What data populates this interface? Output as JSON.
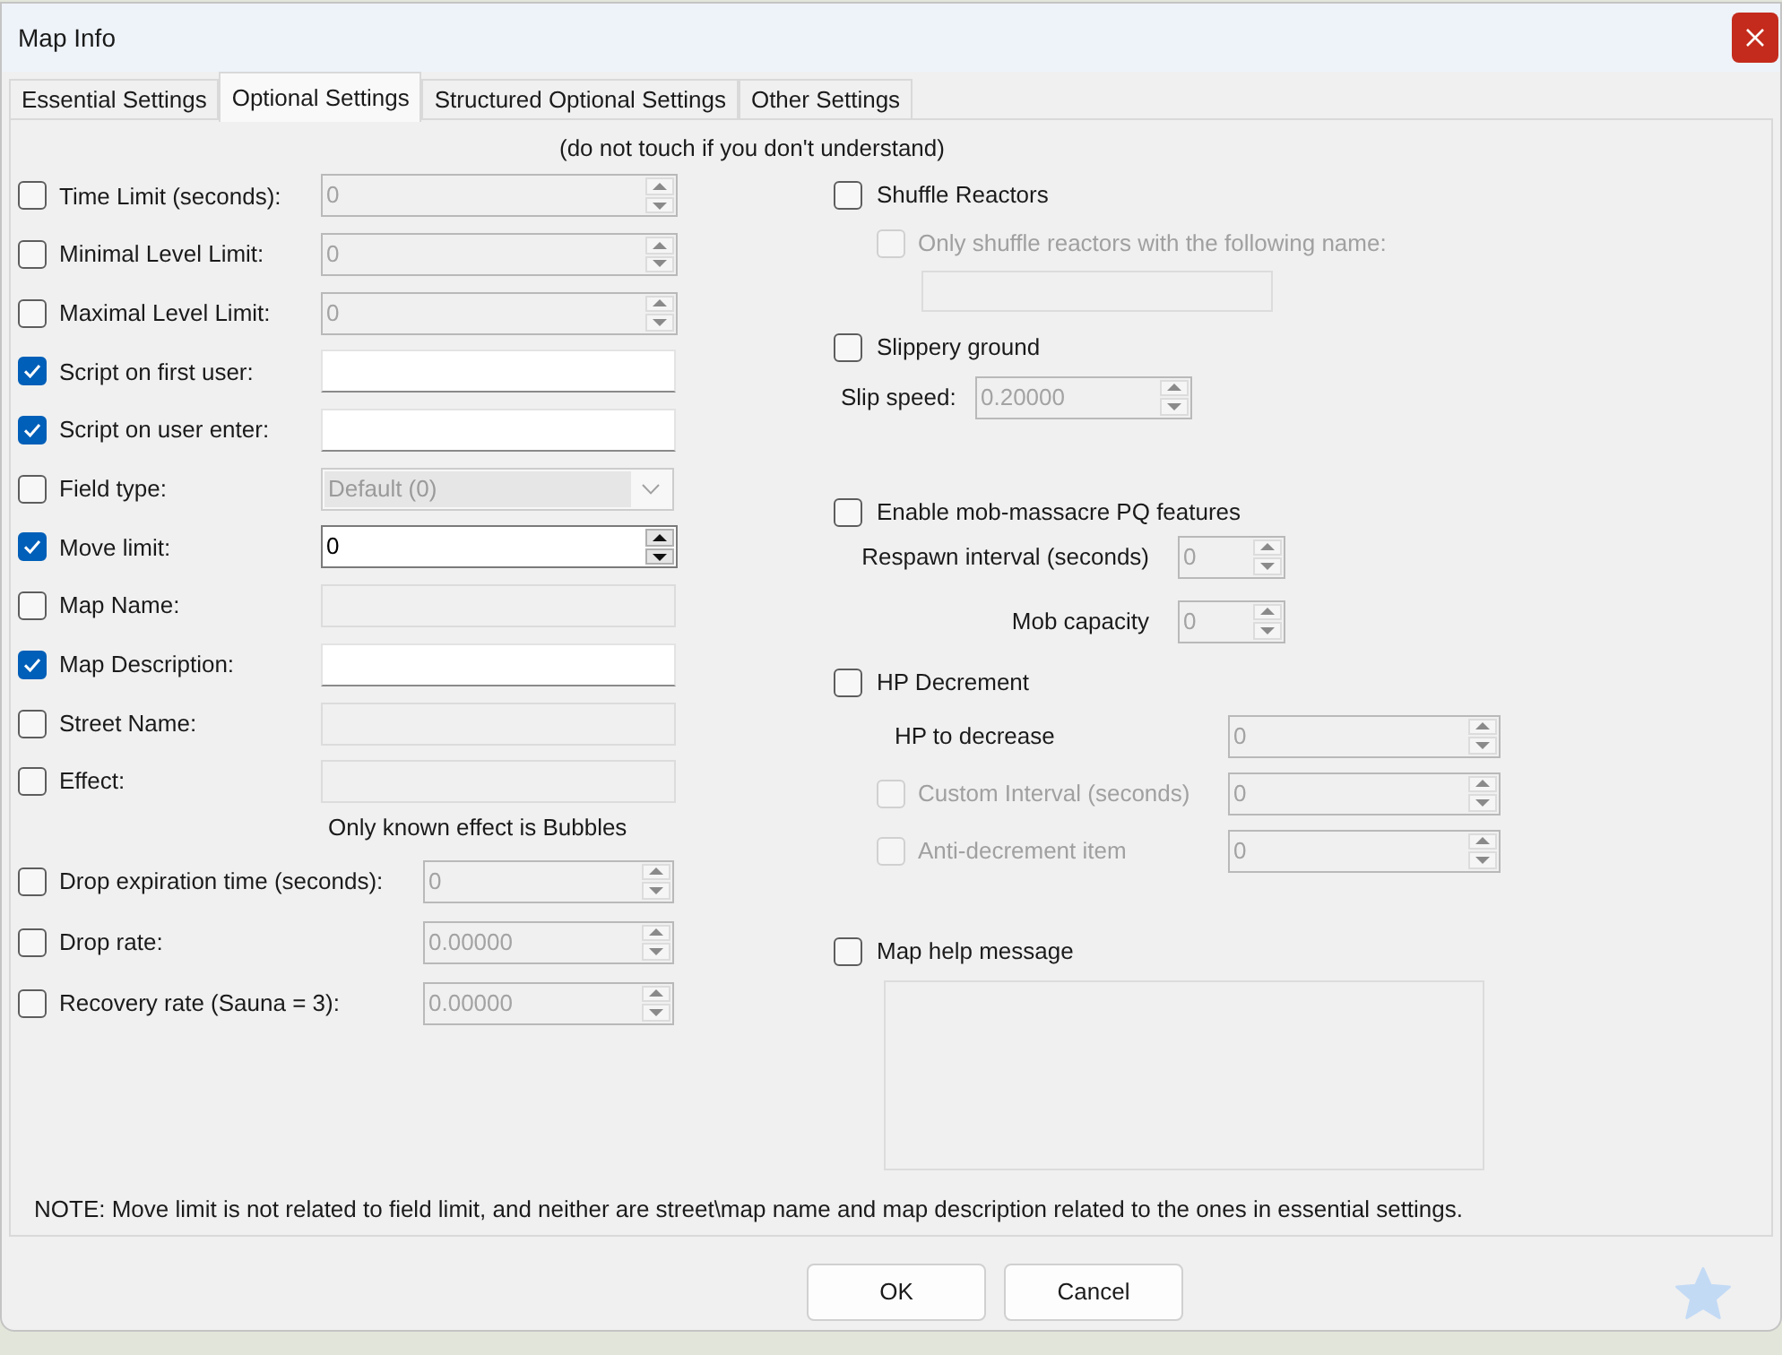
{
  "window": {
    "title": "Map Info"
  },
  "tabs": [
    {
      "label": "Essential Settings",
      "selected": false
    },
    {
      "label": "Optional Settings",
      "selected": true
    },
    {
      "label": "Structured Optional Settings",
      "selected": false
    },
    {
      "label": "Other Settings",
      "selected": false
    }
  ],
  "hint": "(do not touch if you don't understand)",
  "left_settings": [
    {
      "kind": "spin",
      "label": "Time Limit (seconds):",
      "checked": false,
      "value": "0"
    },
    {
      "kind": "spin",
      "label": "Minimal Level Limit:",
      "checked": false,
      "value": "0"
    },
    {
      "kind": "spin",
      "label": "Maximal Level Limit:",
      "checked": false,
      "value": "0"
    },
    {
      "kind": "text",
      "label": "Script on first user:",
      "checked": true
    },
    {
      "kind": "text",
      "label": "Script on user enter:",
      "checked": true
    },
    {
      "kind": "combo",
      "label": "Field type:",
      "checked": false,
      "value": "Default (0)"
    },
    {
      "kind": "spin",
      "label": "Move limit:",
      "checked": true,
      "value": "0"
    },
    {
      "kind": "text",
      "label": "Map Name:",
      "checked": false
    },
    {
      "kind": "text",
      "label": "Map Description:",
      "checked": true
    },
    {
      "kind": "text",
      "label": "Street Name:",
      "checked": false
    },
    {
      "kind": "text",
      "label": "Effect:",
      "checked": false
    },
    {
      "kind": "note",
      "label": "Only known effect is Bubbles"
    }
  ],
  "rate_settings": [
    {
      "label": "Drop expiration time (seconds):",
      "checked": false,
      "value": "0"
    },
    {
      "label": "Drop rate:",
      "checked": false,
      "value": "0.00000"
    },
    {
      "label": "Recovery rate (Sauna = 3):",
      "checked": false,
      "value": "0.00000"
    }
  ],
  "right_sections": [
    {
      "kind": "reactors",
      "label": "Shuffle Reactors",
      "checked": false,
      "children": [
        {
          "kind": "check",
          "label": "Only shuffle reactors with the following name:",
          "checked": false,
          "disabled": true
        },
        {
          "kind": "text",
          "disabled": true
        }
      ]
    },
    {
      "kind": "slip",
      "label": "Slippery ground",
      "checked": false,
      "children": [
        {
          "kind": "spin",
          "label": "Slip speed:",
          "value": "0.20000",
          "disabled": true
        }
      ]
    },
    {
      "kind": "mob",
      "label": "Enable mob-massacre PQ features",
      "checked": false,
      "children": [
        {
          "kind": "spin",
          "label": "Respawn interval (seconds)",
          "value": "0",
          "disabled": true
        },
        {
          "kind": "spin",
          "label": "Mob capacity",
          "value": "0",
          "disabled": true
        }
      ]
    },
    {
      "kind": "hp",
      "label": "HP Decrement",
      "checked": false,
      "children": [
        {
          "kind": "spin",
          "label": "HP to decrease",
          "value": "0",
          "disabled": true
        },
        {
          "kind": "check_spin",
          "label": "Custom Interval (seconds)",
          "checked": false,
          "disabled": true,
          "value": "0"
        },
        {
          "kind": "check_spin",
          "label": "Anti-decrement item",
          "checked": false,
          "disabled": true,
          "value": "0"
        }
      ]
    },
    {
      "kind": "help",
      "label": "Map help message",
      "checked": false,
      "children": [
        {
          "kind": "textarea",
          "disabled": true
        }
      ]
    }
  ],
  "note": "NOTE: Move limit is not related to field limit, and neither are street\\map name and map description related to the ones in essential settings.",
  "buttons": [
    "OK",
    "Cancel"
  ]
}
